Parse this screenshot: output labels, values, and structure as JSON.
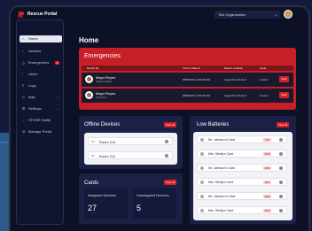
{
  "app": {
    "title": "Rescue Portal",
    "brand_color": "#d81f26"
  },
  "topbar": {
    "org_select": "Test Organization"
  },
  "sidebar": {
    "items": [
      {
        "label": "Home",
        "icon": "home-icon",
        "active": true
      },
      {
        "label": "Devices",
        "icon": "device-icon"
      },
      {
        "label": "Emergencies",
        "icon": "alert-icon",
        "badge": "2"
      },
      {
        "label": "Users",
        "icon": "users-icon"
      },
      {
        "label": "Logs",
        "icon": "logs-icon"
      },
      {
        "label": "Map",
        "icon": "map-icon"
      },
      {
        "label": "Settings",
        "icon": "gear-icon"
      },
      {
        "label": "STORE Notify",
        "icon": "bell-icon"
      },
      {
        "label": "Manage Portal",
        "icon": "admin-icon"
      }
    ]
  },
  "main": {
    "title": "Home",
    "emergencies": {
      "title": "Emergencies",
      "columns": [
        "Report By",
        "Time of Report",
        "Report Location",
        "Level"
      ],
      "rows": [
        {
          "name": "Maya Reyes",
          "phone": "Student Maya",
          "time": "08/05/2021 3:03:18 AM",
          "location": "Large Pool Zone A",
          "level": "Level 1",
          "action": "View"
        },
        {
          "name": "Maya Reyes",
          "phone": "Cell Num",
          "time": "08/05/2021 3:03:18 AM",
          "location": "Large Pool Zone A",
          "level": "Level 1",
          "action": "View"
        }
      ]
    },
    "offline_devices": {
      "title": "Offline Devices",
      "view_all": "View All",
      "items": [
        {
          "label": "Room 214"
        },
        {
          "label": "Room 211"
        }
      ]
    },
    "cards": {
      "title": "Cards",
      "view_all": "View All",
      "assigned_label": "Assigned Devices",
      "assigned_value": "27",
      "unassigned_label": "Unassigned Devices",
      "unassigned_value": "5"
    },
    "low_batteries": {
      "title": "Low Batteries",
      "view_all": "View All",
      "items": [
        {
          "label": "Mr. Johnson's Card",
          "pct": "7%"
        },
        {
          "label": "Mrs. Shelly's Card",
          "pct": "12%"
        },
        {
          "label": "Mr. Johnson's Card",
          "pct": "14%"
        },
        {
          "label": "Mrs. Shelly's Card",
          "pct": "9%"
        },
        {
          "label": "Mr. Johnson's Card",
          "pct": "10%"
        },
        {
          "label": "Mrs. Shelly's Card",
          "pct": "11%"
        }
      ]
    }
  }
}
